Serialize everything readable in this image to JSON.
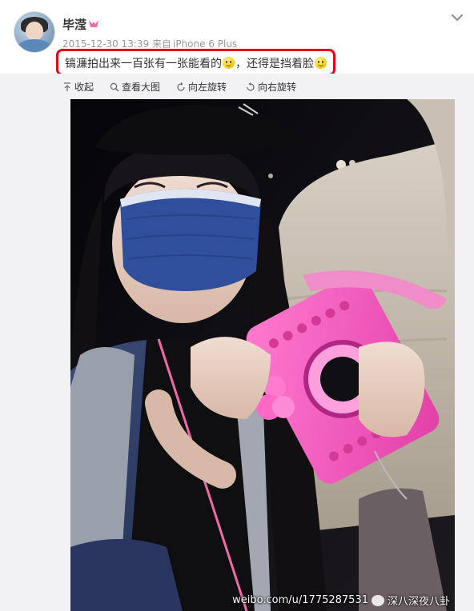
{
  "post": {
    "username": "毕滢",
    "timestamp": "2015-12-30 13:39",
    "source_prefix": "来自",
    "source": "iPhone 6 Plus",
    "text_part1": "镐濂拍出来一百张有一张能看的",
    "text_part2": "，还得是挡着脸",
    "emoji_1": "smile-emoji",
    "emoji_2": "smile-emoji",
    "highlight_color": "#e40613"
  },
  "toolbar": {
    "collapse_label": "收起",
    "view_large_label": "查看大图",
    "rotate_left_label": "向左旋转",
    "rotate_right_label": "向右旋转",
    "collapse_icon": "collapse-up-icon",
    "view_large_icon": "magnify-icon",
    "rotate_left_icon": "rotate-left-icon",
    "rotate_right_icon": "rotate-right-icon"
  },
  "photo": {
    "watermark_site": "weibo.com/u/1775287531",
    "watermark_account": "深八深夜八卦",
    "logo_icon": "wechat-icon"
  },
  "colors": {
    "accent_link": "#333333",
    "meta_text": "#999999",
    "badge_pink": "#f06aa6"
  }
}
